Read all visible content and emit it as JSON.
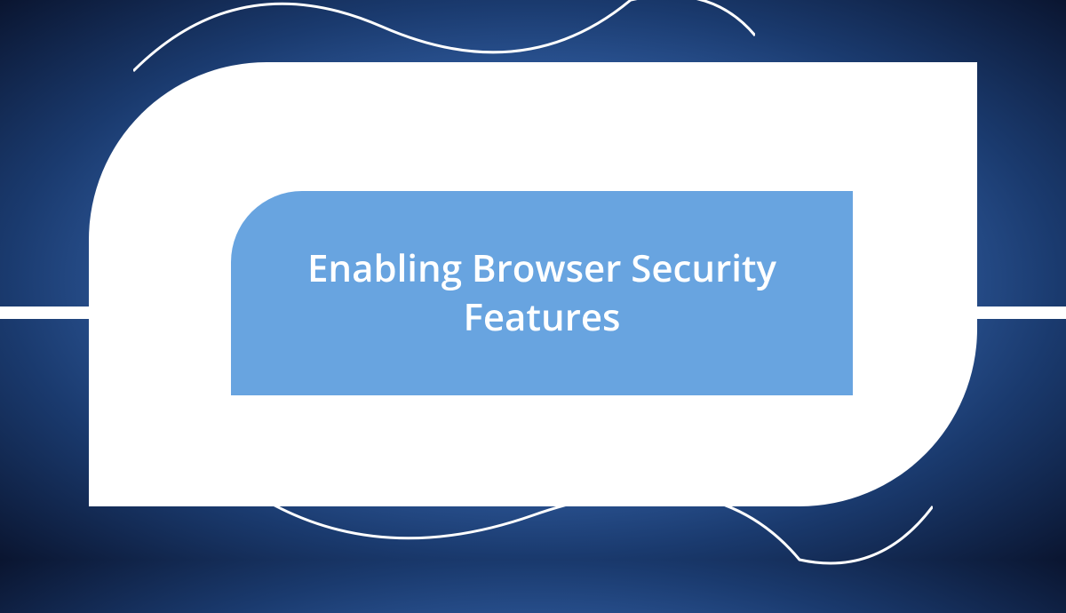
{
  "card": {
    "title": "Enabling Browser Security Features"
  },
  "colors": {
    "inner_bg": "#68a4e0",
    "outer_bg": "#ffffff",
    "text": "#ffffff"
  }
}
